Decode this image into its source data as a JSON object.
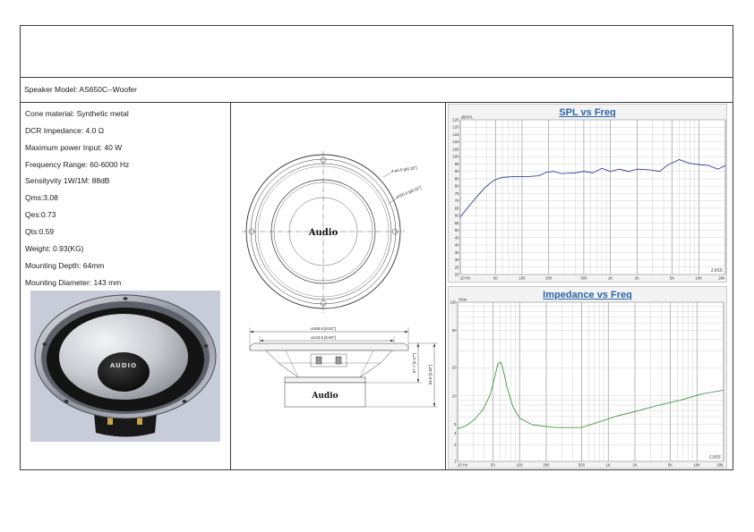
{
  "model": "Speaker Model: AS650C--Woofer",
  "specs": [
    "Cone material: Synthetic metal",
    "DCR Impedance: 4.0 Ω",
    "Maximum power Input: 40 W",
    "Frequency Range: 60-6000 Hz",
    "Sensityvity 1W/1M: 88dB",
    "Qms:3.08",
    "Qes:0.73",
    "Qts:0.59",
    "Weight: 0.93(KG)",
    "Mounting Depth: 64mm",
    "Mounting Diameter: 143 mm"
  ],
  "photo": {
    "logo": "AUDIO"
  },
  "drawing": {
    "logo_front": "Audio",
    "logo_side": "Audio",
    "dim_holes": "4-ø4.5 [ø0.18\"]",
    "dim_pcd": "ø150.0 [ø5.91\"]",
    "dim_outer": "ø165.5 [6.52\"]",
    "dim_cutout": "ø143.5 [5.65\"]",
    "dim_depth_basket": "57.7 [2.27\"]",
    "dim_depth_total": "64.0 [2.52\"]"
  },
  "chart_logo": "LMS",
  "colors": {
    "title": "#2b64a8",
    "spl_line": "#1c2b8f",
    "impedance_line": "#2e8b2e"
  },
  "chart_data": [
    {
      "type": "line",
      "title": "SPL vs Freq",
      "xlabel": "",
      "ylabel": "dBSPL",
      "x_scale": "log",
      "y_scale": "linear",
      "xlim": [
        20,
        20000
      ],
      "ylim": [
        20,
        125
      ],
      "grid": true,
      "x_ticks": [
        {
          "value": 20,
          "label": "20 Hz"
        },
        {
          "value": 50,
          "label": "50"
        },
        {
          "value": 100,
          "label": "100"
        },
        {
          "value": 200,
          "label": "200"
        },
        {
          "value": 500,
          "label": "500"
        },
        {
          "value": 1000,
          "label": "1K"
        },
        {
          "value": 2000,
          "label": "2K"
        },
        {
          "value": 5000,
          "label": "5K"
        },
        {
          "value": 10000,
          "label": "10K"
        },
        {
          "value": 20000,
          "label": "20K"
        }
      ],
      "y_ticks": [
        125,
        120,
        115,
        110,
        105,
        100,
        95,
        90,
        85,
        80,
        75,
        70,
        65,
        60,
        55,
        50,
        45,
        40,
        35,
        30,
        25,
        20
      ],
      "series": [
        {
          "color": "#1c2b8f",
          "x": [
            20,
            24,
            30,
            38,
            48,
            60,
            85,
            120,
            155,
            190,
            230,
            280,
            400,
            500,
            630,
            800,
            1000,
            1250,
            1600,
            2000,
            2800,
            3600,
            4500,
            6000,
            7800,
            10500,
            13000,
            16500,
            20000
          ],
          "y": [
            59,
            65,
            72,
            79,
            84,
            86,
            86.5,
            86.5,
            87,
            89.5,
            90,
            88.5,
            89,
            90,
            89,
            92,
            90,
            91.5,
            90,
            91.5,
            91,
            90,
            94.5,
            98,
            95.5,
            94.5,
            94,
            91.5,
            94
          ]
        }
      ]
    },
    {
      "type": "line",
      "title": "Impedance vs Freq",
      "xlabel": "",
      "ylabel": "Ohm",
      "x_scale": "log",
      "y_scale": "log",
      "xlim": [
        20,
        20000
      ],
      "ylim": [
        2,
        100
      ],
      "grid": true,
      "x_ticks": [
        {
          "value": 20,
          "label": "20 Hz"
        },
        {
          "value": 50,
          "label": "50"
        },
        {
          "value": 100,
          "label": "100"
        },
        {
          "value": 200,
          "label": "200"
        },
        {
          "value": 500,
          "label": "500"
        },
        {
          "value": 1000,
          "label": "1K"
        },
        {
          "value": 2000,
          "label": "2K"
        },
        {
          "value": 5000,
          "label": "5K"
        },
        {
          "value": 10000,
          "label": "10K"
        },
        {
          "value": 20000,
          "label": "20K"
        }
      ],
      "y_ticks": [
        100,
        50,
        20,
        10,
        5,
        4,
        3,
        2
      ],
      "series": [
        {
          "color": "#2e8b2e",
          "x": [
            20,
            25,
            31,
            39,
            47,
            53,
            57,
            61,
            65,
            72,
            84,
            100,
            140,
            250,
            500,
            800,
            1250,
            2000,
            3600,
            6500,
            11500,
            20000
          ],
          "y": [
            4.5,
            4.8,
            5.6,
            7.2,
            10.5,
            16.5,
            22,
            23,
            19.5,
            12.5,
            7.7,
            5.8,
            4.9,
            4.6,
            4.6,
            5.3,
            6.1,
            6.8,
            7.9,
            9.0,
            10.5,
            11.5
          ]
        }
      ]
    }
  ]
}
